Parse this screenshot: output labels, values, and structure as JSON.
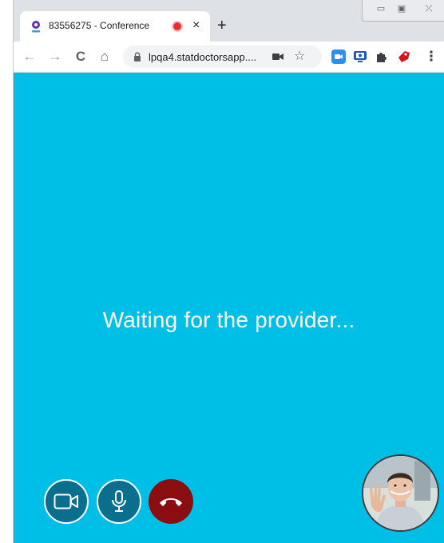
{
  "tab": {
    "title": "83556275 - Conference",
    "close_glyph": "×",
    "new_tab_glyph": "+"
  },
  "window_controls": {
    "minimize_glyph": "▭",
    "restore_glyph": "▣",
    "close_glyph": "⤫"
  },
  "toolbar": {
    "url": "lpqa4.statdoctorsapp....",
    "back_glyph": "←",
    "forward_glyph": "→",
    "reload_glyph": "C",
    "home_glyph": "⌂",
    "star_glyph": "☆",
    "menu_glyph": "⋮"
  },
  "main": {
    "status_text": "Waiting for the provider..."
  },
  "colors": {
    "background": "#00bfe6",
    "control_button": "#0a6e8f",
    "end_call": "#8a0e10",
    "recording_dot": "#e5312f"
  },
  "icons": {
    "tab_favicon": "location-pin-icon",
    "recording": "recording-dot-icon",
    "camera_toggle": "video-camera-icon",
    "mic_toggle": "microphone-icon",
    "end_call": "hang-up-icon"
  }
}
